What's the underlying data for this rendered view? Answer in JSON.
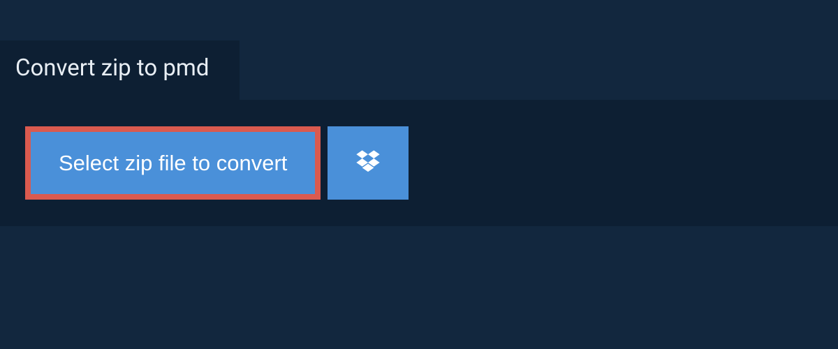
{
  "tab": {
    "title": "Convert zip to pmd"
  },
  "actions": {
    "select_label": "Select zip file to convert"
  },
  "colors": {
    "page_bg": "#12273e",
    "panel_bg": "#0d1f33",
    "button_bg": "#4a90d9",
    "highlight_border": "#da5a4f",
    "text_light": "#ffffff"
  }
}
